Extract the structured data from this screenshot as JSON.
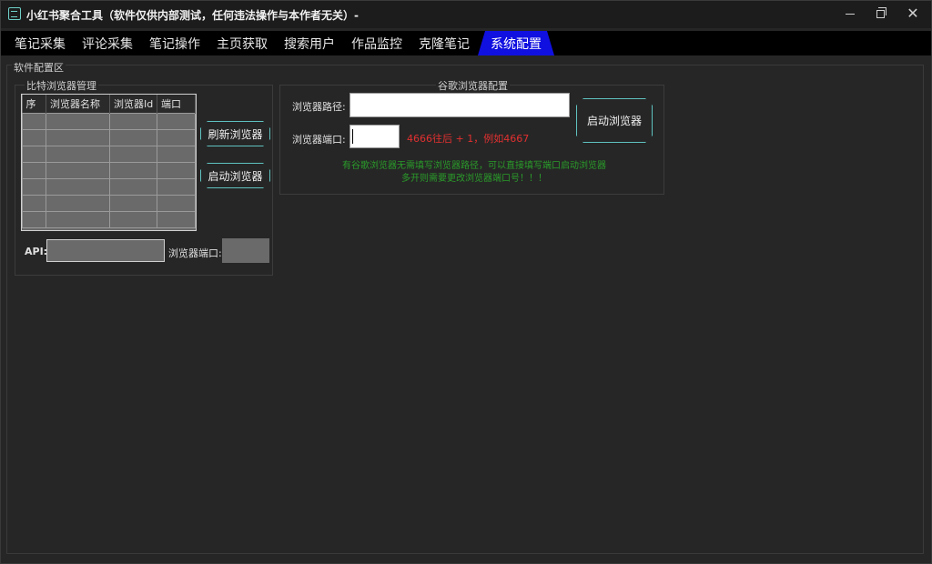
{
  "window": {
    "title": "小红书聚合工具（软件仅供内部测试，任何违法操作与本作者无关）-",
    "controls": [
      "minimize",
      "restore",
      "close"
    ]
  },
  "tabs": [
    {
      "label": "笔记采集"
    },
    {
      "label": "评论采集"
    },
    {
      "label": "笔记操作"
    },
    {
      "label": "主页获取"
    },
    {
      "label": "搜索用户"
    },
    {
      "label": "作品监控"
    },
    {
      "label": "克隆笔记"
    },
    {
      "label": "系统配置",
      "active": true
    }
  ],
  "config": {
    "zone_title": "软件配置区",
    "bitbrowser": {
      "title": "比特浏览器管理",
      "columns": [
        "序",
        "浏览器名称",
        "浏览器Id",
        "端口"
      ],
      "refresh_label": "刷新浏览器",
      "start_label": "启动浏览器",
      "api_label": "API:",
      "api_value": "",
      "port_label": "浏览器端口:",
      "port_value": ""
    },
    "chrome": {
      "title": "谷歌浏览器配置",
      "path_label": "浏览器路径:",
      "path_value": "",
      "port_label": "浏览器端口:",
      "port_value": "",
      "port_hint": "4666往后 + 1，例如4667",
      "start_label": "启动浏览器",
      "note_line1": "有谷歌浏览器无需填写浏览器路径，可以直接填写端口启动浏览器",
      "note_line2": "多开则需要更改浏览器端口号！！！"
    }
  },
  "colors": {
    "active_tab": "#1010e0",
    "button_border": "#5fc2c0",
    "hint_red": "#e23030",
    "note_green": "#2a9c2a"
  }
}
